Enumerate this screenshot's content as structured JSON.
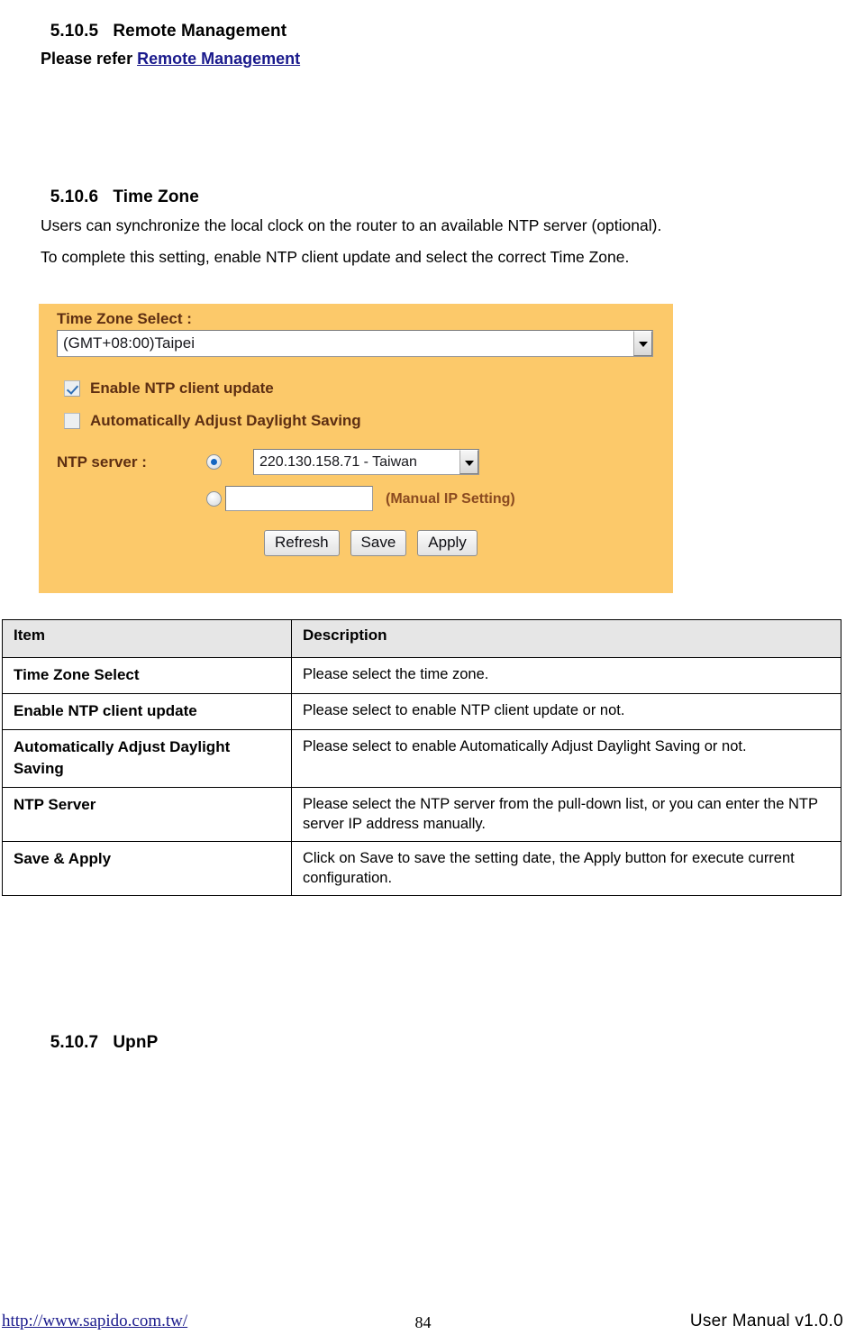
{
  "document": {
    "sections": [
      {
        "number": "5.10.5",
        "title": "Remote Management"
      },
      {
        "number": "5.10.6",
        "title": "Time Zone"
      },
      {
        "number": "5.10.7",
        "title": "UpnP"
      }
    ],
    "refer_line": {
      "prefix": "Please refer ",
      "link_text": "Remote Management"
    },
    "paragraphs": [
      "Users can synchronize the local clock on the router to an available NTP server (optional).",
      "To complete this setting, enable NTP client update and select the correct Time Zone."
    ]
  },
  "panel": {
    "time_zone_label": "Time Zone Select :",
    "time_zone_value": "(GMT+08:00)Taipei",
    "checkbox_ntp": {
      "label": "Enable NTP client update",
      "checked": true
    },
    "checkbox_dst": {
      "label": "Automatically Adjust Daylight Saving",
      "checked": false
    },
    "ntp_server_label": "NTP server :",
    "ntp_server_value": "220.130.158.71 - Taiwan",
    "manual_ip_value": "",
    "manual_ip_hint": "(Manual IP Setting)",
    "buttons": [
      "Refresh",
      "Save",
      "Apply"
    ],
    "background_color": "#fcc96a",
    "label_color": "#5d2e12"
  },
  "table": {
    "headers": [
      "Item",
      "Description"
    ],
    "rows": [
      {
        "item": "Time Zone Select",
        "description": "Please select the time zone."
      },
      {
        "item": "Enable NTP client update",
        "description": "Please select to enable NTP client update or not."
      },
      {
        "item": "Automatically Adjust Daylight Saving",
        "description": "Please select to enable Automatically Adjust Daylight Saving or not."
      },
      {
        "item": "NTP Server",
        "description": "Please select the NTP server from the pull-down list, or you can enter the NTP server IP address manually."
      },
      {
        "item": "Save & Apply",
        "description": "Click on Save to save the setting date, the Apply button for execute current configuration."
      }
    ]
  },
  "footer": {
    "url": "http://www.sapido.com.tw/",
    "page_number": "84",
    "manual": "User  Manual  v1.0.0"
  }
}
